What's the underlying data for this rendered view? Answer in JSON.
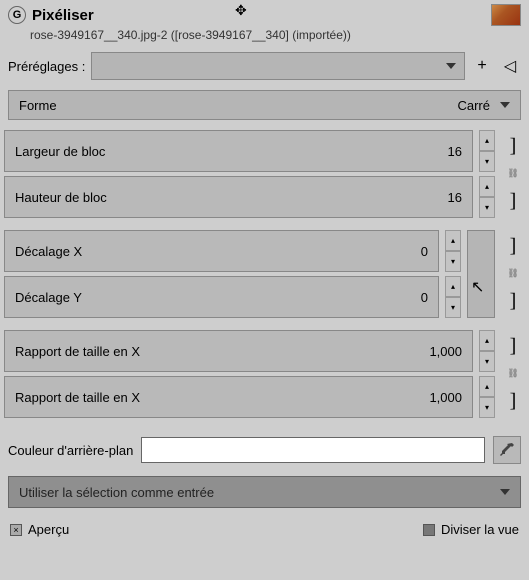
{
  "header": {
    "title": "Pixéliser",
    "subtitle": "rose-3949167__340.jpg-2 ([rose-3949167__340] (importée))"
  },
  "presets": {
    "label": "Préréglages :"
  },
  "shape": {
    "label": "Forme",
    "value": "Carré"
  },
  "params": {
    "block_w": {
      "label": "Largeur de bloc",
      "value": "16"
    },
    "block_h": {
      "label": "Hauteur de bloc",
      "value": "16"
    },
    "offset_x": {
      "label": "Décalage X",
      "value": "0"
    },
    "offset_y": {
      "label": "Décalage Y",
      "value": "0"
    },
    "ratio_x": {
      "label": "Rapport de taille en X",
      "value": "1,000"
    },
    "ratio_y": {
      "label": "Rapport de taille en X",
      "value": "1,000"
    }
  },
  "bgcolor": {
    "label": "Couleur d'arrière-plan"
  },
  "selection": {
    "label": "Utiliser la sélection comme entrée"
  },
  "footer": {
    "preview": "Aperçu",
    "split": "Diviser la vue"
  }
}
